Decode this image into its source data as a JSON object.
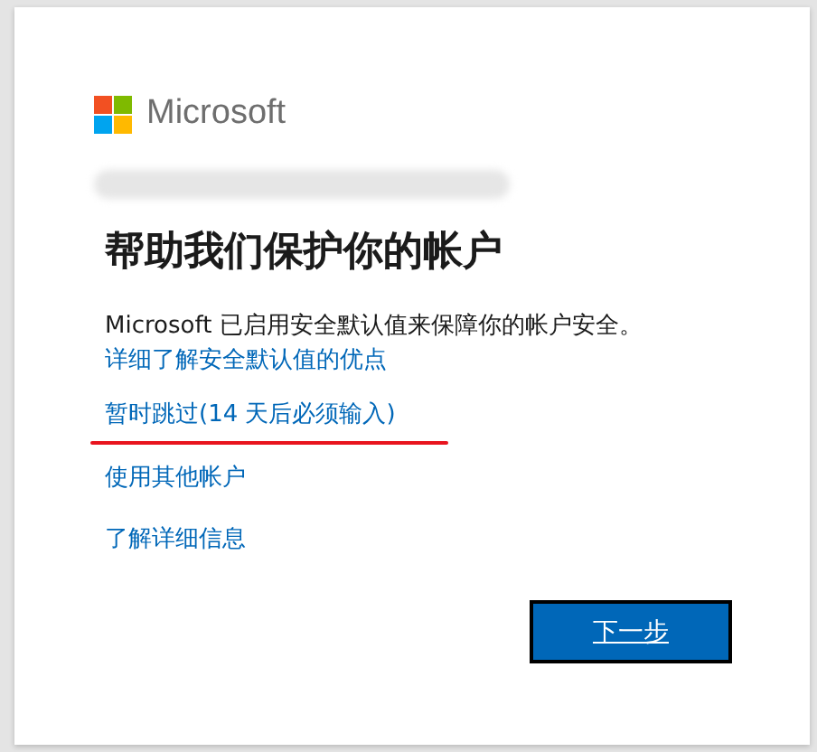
{
  "logo": {
    "text": "Microsoft"
  },
  "title": "帮助我们保护你的帐户",
  "description": "Microsoft 已启用安全默认值来保障你的帐户安全。",
  "links": [
    {
      "label": "详细了解安全默认值的优点",
      "underlined_by_hand": false
    },
    {
      "label": "暂时跳过(14 天后必须输入)",
      "underlined_by_hand": true
    },
    {
      "label": "使用其他帐户",
      "underlined_by_hand": false
    },
    {
      "label": "了解详细信息",
      "underlined_by_hand": false
    }
  ],
  "next_button": {
    "label": "下一步",
    "focused": true
  }
}
